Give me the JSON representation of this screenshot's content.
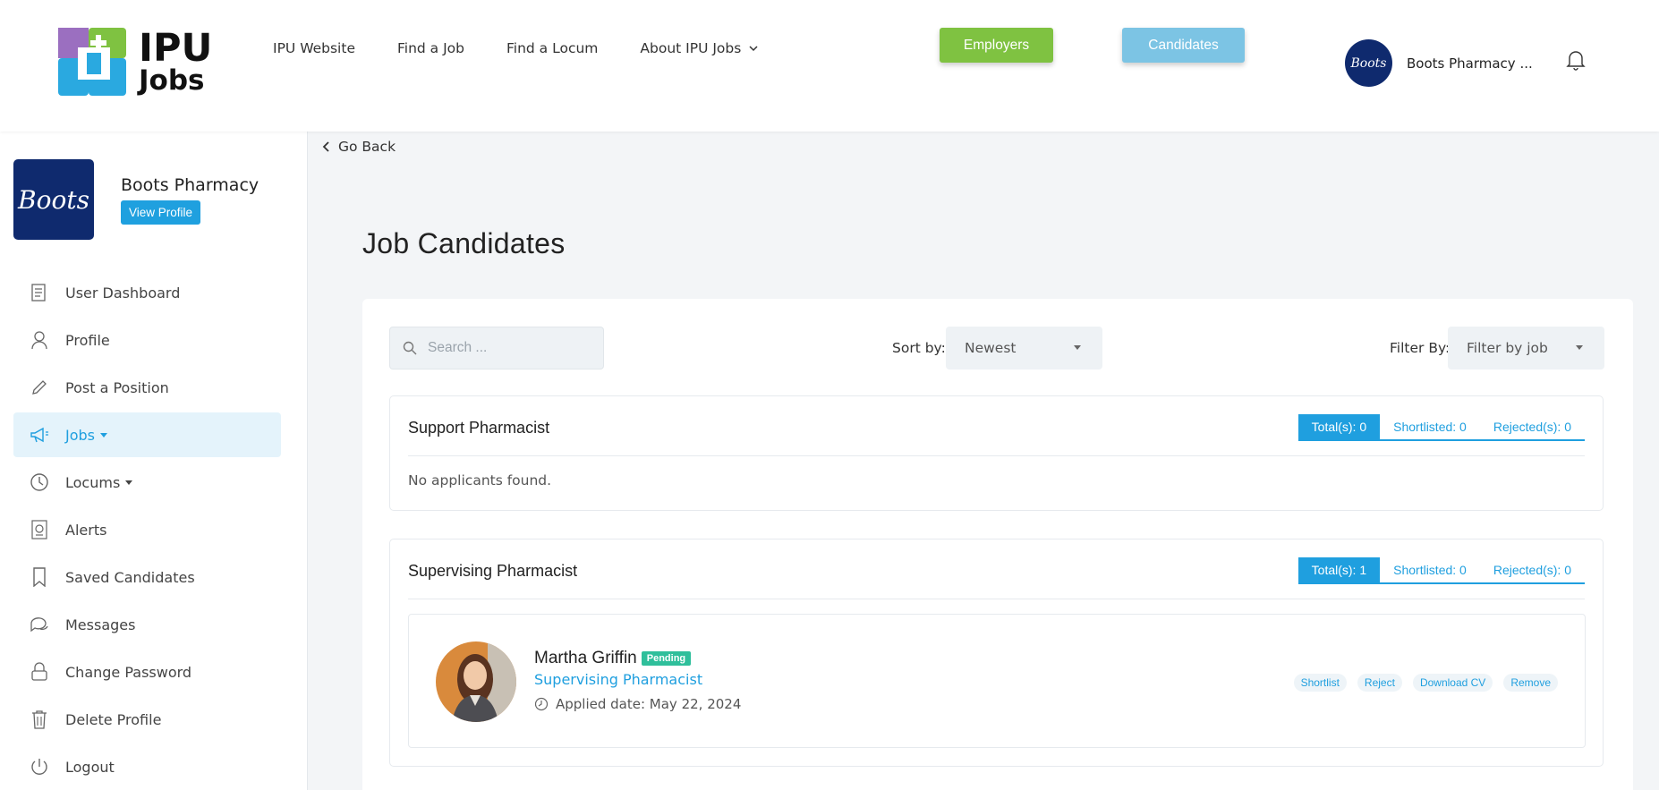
{
  "header": {
    "logo": {
      "line1": "IPU",
      "line2": "Jobs"
    },
    "nav": [
      {
        "label": "IPU Website"
      },
      {
        "label": "Find a Job"
      },
      {
        "label": "Find a Locum"
      },
      {
        "label": "About IPU Jobs"
      }
    ],
    "employers_label": "Employers",
    "candidates_label": "Candidates",
    "account_name": "Boots Pharmacy ...",
    "account_avatar_text": "Boots"
  },
  "sidebar": {
    "company_logo_text": "Boots",
    "company_name": "Boots Pharmacy",
    "view_profile_label": "View Profile",
    "items": [
      {
        "label": "User Dashboard",
        "icon": "dashboard-icon"
      },
      {
        "label": "Profile",
        "icon": "user-icon"
      },
      {
        "label": "Post a Position",
        "icon": "pencil-icon"
      },
      {
        "label": "Jobs",
        "icon": "megaphone-icon",
        "active": true
      },
      {
        "label": "Locums",
        "icon": "clock-icon"
      },
      {
        "label": "Alerts",
        "icon": "alert-icon"
      },
      {
        "label": "Saved Candidates",
        "icon": "bookmark-icon"
      },
      {
        "label": "Messages",
        "icon": "chat-icon"
      },
      {
        "label": "Change Password",
        "icon": "lock-icon"
      },
      {
        "label": "Delete Profile",
        "icon": "trash-icon"
      },
      {
        "label": "Logout",
        "icon": "power-icon"
      }
    ]
  },
  "main": {
    "go_back_label": "Go Back",
    "title": "Job Candidates",
    "search_placeholder": "Search ...",
    "sort_label": "Sort by:",
    "sort_value": "Newest",
    "filter_label": "Filter By:",
    "filter_value": "Filter by job",
    "jobs": [
      {
        "title": "Support Pharmacist",
        "tabs": [
          "Total(s): 0",
          "Shortlisted: 0",
          "Rejected(s): 0"
        ],
        "empty_text": "No applicants found."
      },
      {
        "title": "Supervising Pharmacist",
        "tabs": [
          "Total(s): 1",
          "Shortlisted: 0",
          "Rejected(s): 0"
        ],
        "candidate": {
          "name": "Martha Griffin",
          "status": "Pending",
          "role": "Supervising Pharmacist",
          "applied": "Applied date: May 22, 2024",
          "actions": [
            "Shortlist",
            "Reject",
            "Download CV",
            "Remove"
          ]
        }
      }
    ]
  },
  "colors": {
    "brand_blue": "#1f9fdf",
    "employers_green": "#7fc241",
    "candidates_blue": "#7cc4e4",
    "pending_badge": "#2fbf9b",
    "boots_navy": "#0f2a6e"
  }
}
